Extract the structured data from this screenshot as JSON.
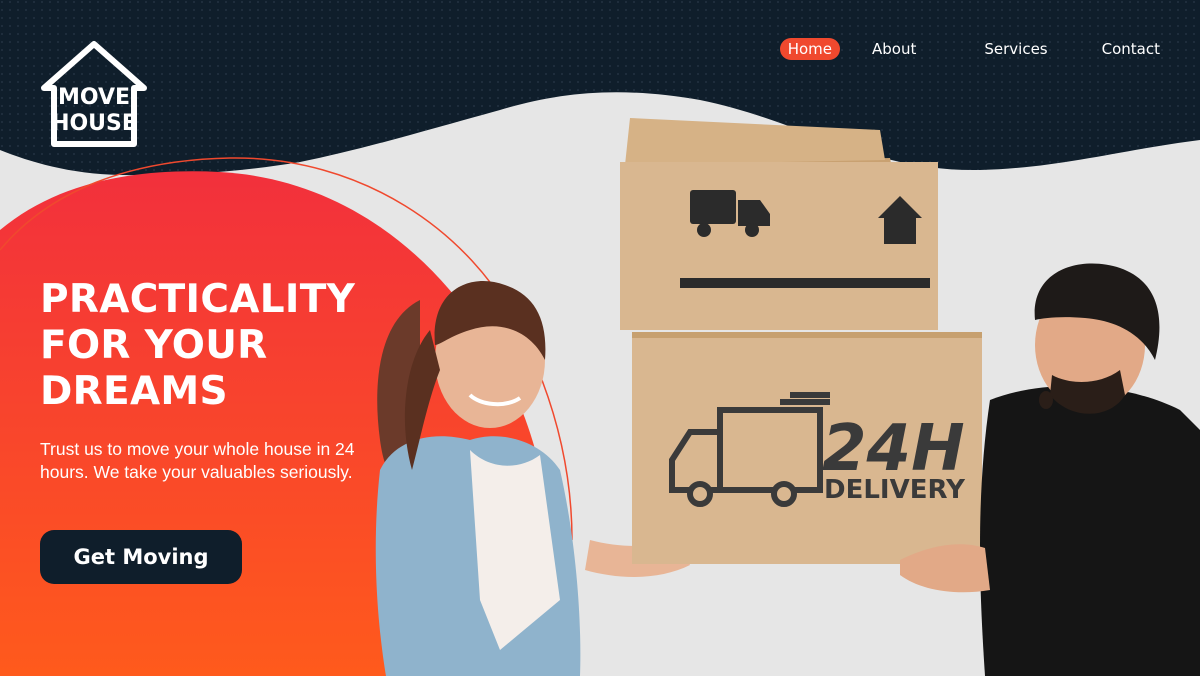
{
  "brand": {
    "logo_line1": "MOVE",
    "logo_line2": "HOUSE"
  },
  "nav": {
    "items": [
      "Home",
      "About",
      "Services",
      "Contact"
    ],
    "active": "Home"
  },
  "hero": {
    "headline": "PRACTICALITY FOR YOUR DREAMS",
    "subtext": "Trust us to move your whole house in 24 hours. We take your valuables seriously.",
    "cta_label": "Get Moving"
  },
  "box_print": {
    "big": "24H",
    "small": "DELIVERY"
  },
  "colors": {
    "navy": "#0f1e2b",
    "accent_red": "#f0492e",
    "gradient_top": "#f2383a",
    "gradient_bottom": "#ff5a1c",
    "background": "#e6e6e6",
    "cardboard": "#d9b790"
  }
}
